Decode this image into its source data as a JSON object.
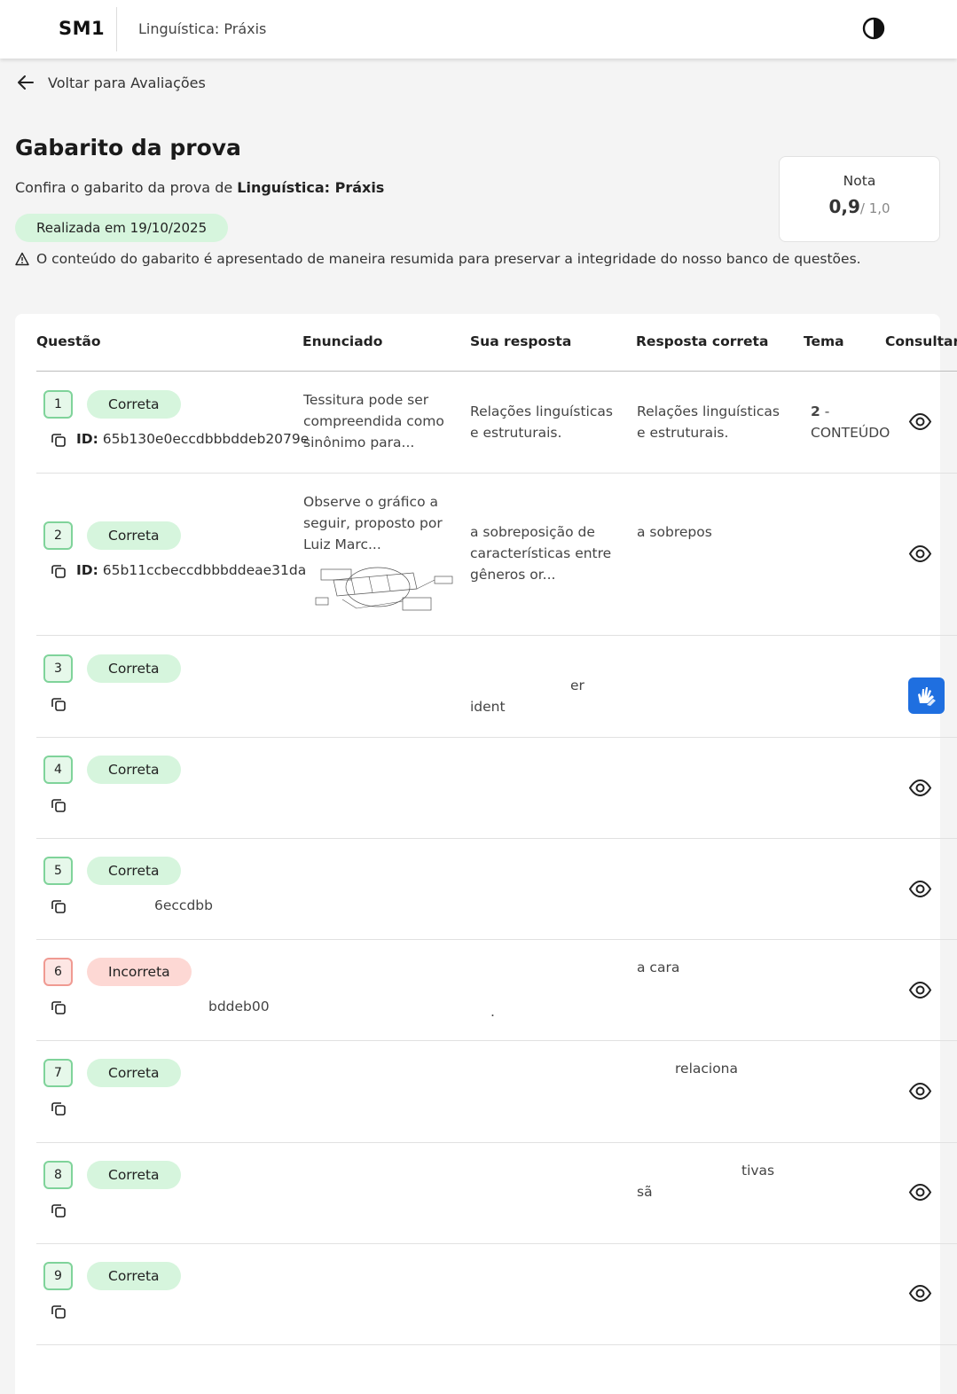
{
  "header": {
    "logo": "SM1",
    "course_title": "Linguística: Práxis"
  },
  "back_link": {
    "label": "Voltar para Avaliações"
  },
  "page": {
    "title": "Gabarito da prova",
    "subtitle_prefix": "Confira o gabarito da prova de ",
    "subtitle_course": "Linguística: Práxis",
    "date_badge": "Realizada em 19/10/2025",
    "warning": "O conteúdo do gabarito é apresentado de maneira resumida para preservar a integridade do nosso banco de questões."
  },
  "grade": {
    "label": "Nota",
    "value": "0,9",
    "max": "/ 1,0"
  },
  "table": {
    "columns": {
      "question": "Questão",
      "statement": "Enunciado",
      "your_answer": "Sua resposta",
      "correct_answer": "Resposta correta",
      "theme": "Tema",
      "consult": "Consultar"
    },
    "id_label": "ID:",
    "rows": [
      {
        "number": "1",
        "status": "Correta",
        "id": "65b130e0eccdbbbddeb2079e",
        "statement": "Tessitura pode ser compreendida como sinônimo para...",
        "your_answer": "Relações linguísticas e estruturais.",
        "correct_answer": "Relações linguísticas e estruturais.",
        "theme_num": "2",
        "theme_sep": " -",
        "theme_name": "CONTEÚDO"
      },
      {
        "number": "2",
        "status": "Correta",
        "id": "65b11ccbeccdbbbddeae31da",
        "statement": "Observe o gráfico a seguir, proposto por Luiz Marc...",
        "your_answer": "a sobreposição de características entre gêneros or...",
        "correct_answer": "a sobrepos"
      },
      {
        "number": "3",
        "status": "Correta",
        "frag_a": "er",
        "frag_b": "ident"
      },
      {
        "number": "4",
        "status": "Correta"
      },
      {
        "number": "5",
        "status": "Correta",
        "frag_id": "6eccdbb"
      },
      {
        "number": "6",
        "status": "Incorreta",
        "frag_id": "bddeb00",
        "frag_answer": "a cara",
        "frag_dot": "."
      },
      {
        "number": "7",
        "status": "Correta",
        "frag_answer": "relaciona"
      },
      {
        "number": "8",
        "status": "Correta",
        "frag_a": "tivas",
        "frag_b": "sã"
      },
      {
        "number": "9",
        "status": "Correta"
      }
    ]
  },
  "icons": {
    "back": "arrow-left-icon",
    "contrast": "contrast-icon",
    "warning": "warning-icon",
    "copy": "copy-icon",
    "view": "eye-icon",
    "libras": "sign-language-icon"
  },
  "colors": {
    "correct_bg": "#d6f5dd",
    "correct_border": "#7fd39a",
    "wrong_bg": "#fdd8d4",
    "wrong_border": "#f09a92",
    "libras_button": "#1f6fe0"
  }
}
